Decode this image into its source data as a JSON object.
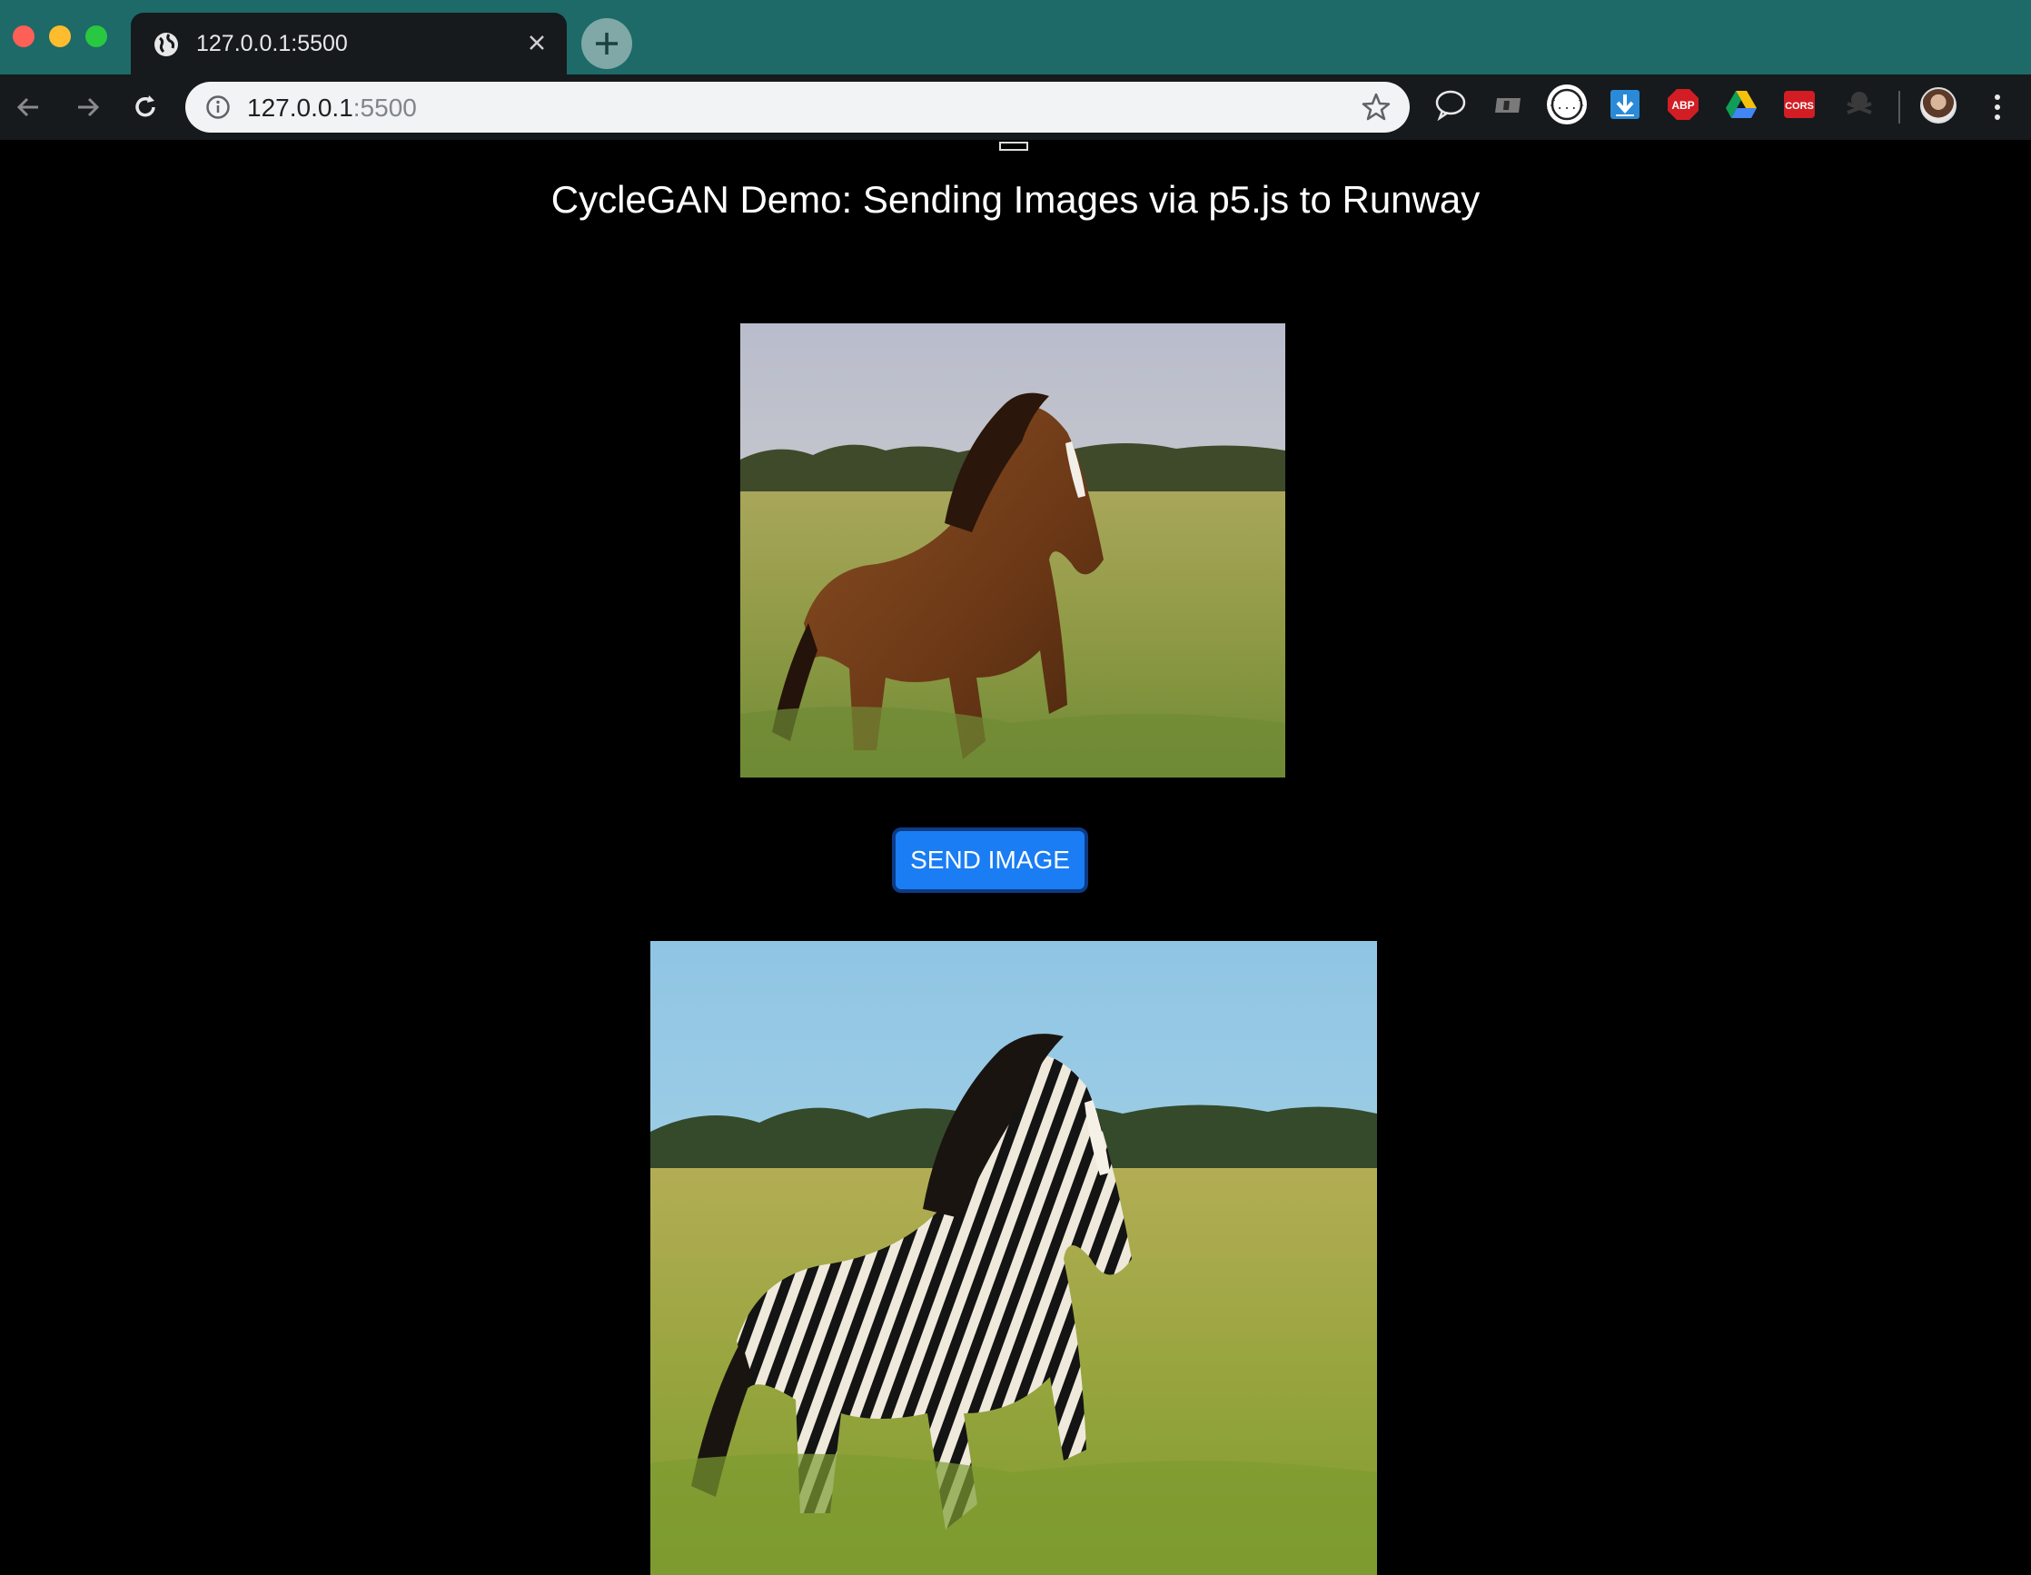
{
  "browser": {
    "tab_title": "127.0.0.1:5500",
    "url_host": "127.0.0.1",
    "url_port": ":5500",
    "extensions": [
      {
        "name": "chat-bubble-icon"
      },
      {
        "name": "card-icon"
      },
      {
        "name": "json-viewer-icon"
      },
      {
        "name": "download-icon"
      },
      {
        "name": "adblock-icon",
        "label": "ABP"
      },
      {
        "name": "google-drive-icon"
      },
      {
        "name": "cors-icon",
        "label": "CORS"
      },
      {
        "name": "pirate-icon"
      }
    ],
    "accent_color": "#1d6a68"
  },
  "page": {
    "title": "CycleGAN Demo: Sending Images via p5.js to Runway",
    "send_button_label": "SEND IMAGE",
    "button_color": "#1a7df3",
    "input_image": "horse photo",
    "output_image": "zebra generated"
  }
}
